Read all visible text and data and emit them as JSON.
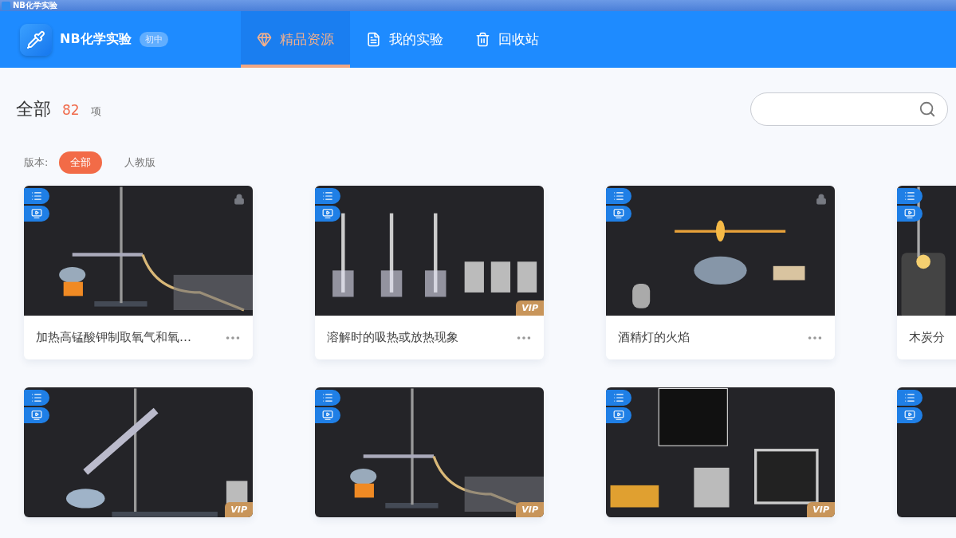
{
  "window": {
    "title": "NB化学实验"
  },
  "brand": {
    "name": "NB化学实验",
    "level": "初中"
  },
  "nav": [
    {
      "label": "精品资源",
      "selected": true
    },
    {
      "label": "我的实验",
      "selected": false
    },
    {
      "label": "回收站",
      "selected": false
    }
  ],
  "heading": {
    "title": "全部",
    "count": "82",
    "unit": "项"
  },
  "filter": {
    "label": "版本:",
    "options": [
      {
        "label": "全部",
        "selected": true
      },
      {
        "label": "人教版",
        "selected": false
      }
    ]
  },
  "cards": [
    {
      "title": "加热高锰酸钾制取氧气和氧…",
      "access": {
        "kind": "lock"
      }
    },
    {
      "title": "溶解时的吸热或放热现象",
      "access": {
        "kind": "vip",
        "label": "VIP"
      }
    },
    {
      "title": "酒精灯的火焰",
      "access": {
        "kind": "lock"
      }
    },
    {
      "title": "木炭分",
      "access": {
        "kind": "none"
      }
    },
    {
      "access": {
        "kind": "vip",
        "label": "VIP"
      }
    },
    {
      "access": {
        "kind": "vip",
        "label": "VIP"
      }
    },
    {
      "access": {
        "kind": "vip",
        "label": "VIP"
      }
    },
    {
      "access": {
        "kind": "none"
      }
    }
  ]
}
